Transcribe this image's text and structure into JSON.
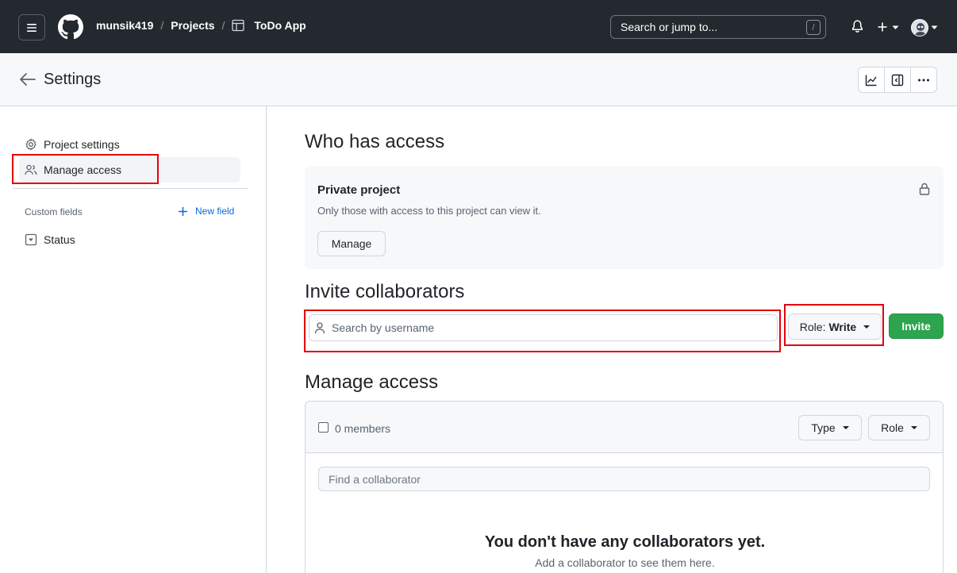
{
  "topbar": {
    "breadcrumbs": [
      "munsik419",
      "Projects",
      "ToDo App"
    ],
    "search_placeholder": "Search or jump to...",
    "search_shortcut": "/",
    "icons": [
      "menu-icon",
      "github-logo",
      "project-table-icon",
      "bell-icon",
      "plus-icon",
      "avatar"
    ]
  },
  "header": {
    "title": "Settings",
    "icons": [
      "arrow-left-icon",
      "graph-icon",
      "sidebar-icon",
      "kebab-icon"
    ]
  },
  "sidebar": {
    "items": [
      {
        "label": "Project settings",
        "icon": "gear-icon",
        "active": false
      },
      {
        "label": "Manage access",
        "icon": "people-icon",
        "active": true
      }
    ],
    "custom_fields_label": "Custom fields",
    "new_field_label": "New field",
    "fields": [
      {
        "label": "Status",
        "icon": "single-select-icon"
      }
    ]
  },
  "main": {
    "who_has_access": {
      "title": "Who has access",
      "visibility_title": "Private project",
      "visibility_desc": "Only those with access to this project can view it.",
      "manage_label": "Manage"
    },
    "invite": {
      "title": "Invite collaborators",
      "search_placeholder": "Search by username",
      "role_prefix": "Role:",
      "role_value": "Write",
      "invite_label": "Invite"
    },
    "manage_access": {
      "title": "Manage access",
      "members_label": "0 members",
      "type_filter": "Type",
      "role_filter": "Role",
      "find_placeholder": "Find a collaborator",
      "empty_title": "You don't have any collaborators yet.",
      "empty_desc": "Add a collaborator to see them here."
    }
  },
  "colors": {
    "topbar_bg": "#24292f",
    "accent": "#0969da",
    "invite_green": "#2da44e",
    "highlight_red": "#e3000f"
  }
}
